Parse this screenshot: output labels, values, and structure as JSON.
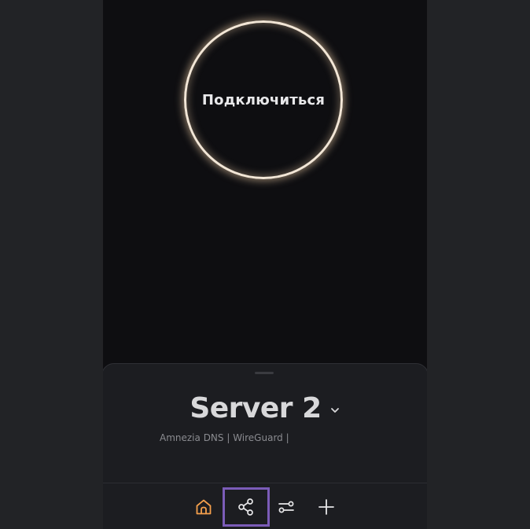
{
  "connect": {
    "label": "Подключиться"
  },
  "server": {
    "name": "Server 2",
    "description": "Amnezia DNS | WireGuard |"
  },
  "tabs": [
    {
      "icon": "home-icon",
      "active": true
    },
    {
      "icon": "share-icon",
      "highlighted": true
    },
    {
      "icon": "settings-sliders-icon"
    },
    {
      "icon": "plus-icon"
    }
  ],
  "colors": {
    "background": "#222326",
    "app_background": "#0e0e11",
    "drawer_background": "#1c1d21",
    "active_tab": "#f5a04c",
    "highlight_border": "#7b5cb8",
    "ring": "#f2e6d6"
  }
}
